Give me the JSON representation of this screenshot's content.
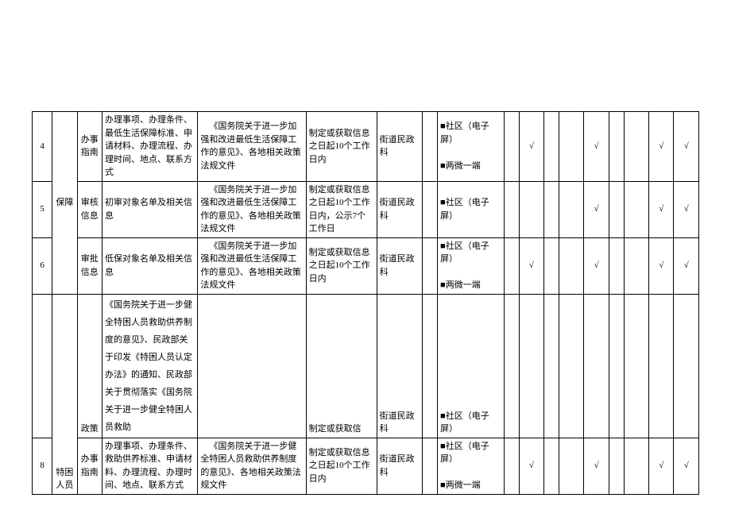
{
  "check": "√",
  "rows": [
    {
      "num": "4",
      "type": "办事指南",
      "content": "办理事项、办理条件、最低生活保障标准、申请材料、办理流程、办理时间、地点、联系方式",
      "basis": "《国务院关于进一步加强和改进最低生活保障工作的意见》、各地相关政策法规文件",
      "time": "制定或获取信息之日起10个工作日内",
      "dept": "街道民政科",
      "channel1": "■社区（电子屏）",
      "channel2": "■两微一端",
      "c1": true,
      "c2": false,
      "c3": true,
      "c4": false,
      "c5": true,
      "c6": true
    },
    {
      "num": "5",
      "cat": "保障",
      "type": "审核信息",
      "content": "初审对象名单及相关信息",
      "basis": "《国务院关于进一步加强和改进最低生活保障工作的意见》、各地相关政策法规文件",
      "time": "制定或获取信息之日起10个工作日内，公示7个工作日",
      "dept": "街道民政科",
      "channel1": "■社区（电子屏）",
      "c1": false,
      "c2": false,
      "c3": true,
      "c4": false,
      "c5": true,
      "c6": true
    },
    {
      "num": "6",
      "type": "审批信息",
      "content": "低保对象名单及相关信息",
      "basis": "《国务院关于进一步加强和改进最低生活保障工作的意见》、各地相关政策法规文件",
      "time": "制定或获取信息之日起10个工作日内",
      "dept": "街道民政科",
      "channel1": "■社区（电子屏）",
      "channel2": "■两微一端",
      "c1": true,
      "c2": false,
      "c3": true,
      "c4": false,
      "c5": true,
      "c6": true
    },
    {
      "num": "",
      "type": "政策",
      "content": "《国务院关于进一步健全特困人员救助供养制度的意见》、民政部关于印发《特困人员认定办法》的通知、民政部关于贯彻落实《国务院关于进一步健全特困人员救助",
      "basis": "",
      "time": "制定或获取信",
      "dept": "街道民政科",
      "channel1": "■社区（电子屏）",
      "tall": true
    },
    {
      "num": "8",
      "cat": "特困人员",
      "type": "办事指南",
      "content": "办理事项、办理条件、救助供养标准、申请材料、办理流程、办理时间、地点、联系方式",
      "basis": "《国务院关于进一步健全特困人员救助供养制度的意见》、各地相关政策法规文件",
      "time": "制定或获取信息之日起10个工作日内",
      "dept": "街道民政科",
      "channel1": "■社区（电子屏）",
      "channel2": "■两微一端",
      "c1": true,
      "c2": false,
      "c3": true,
      "c4": false,
      "c5": true,
      "c6": true
    }
  ]
}
